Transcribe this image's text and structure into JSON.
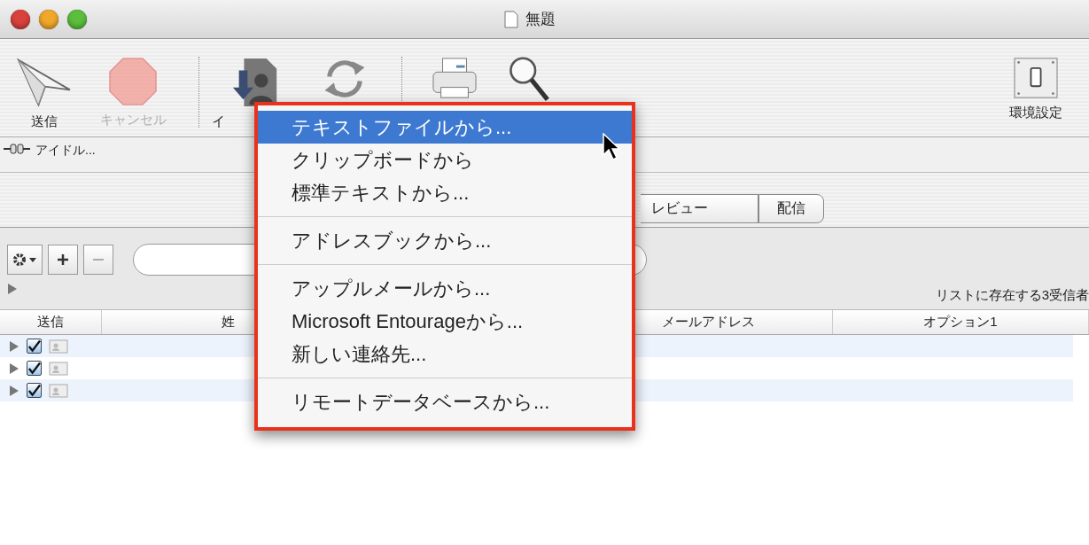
{
  "window": {
    "title": "無題"
  },
  "toolbar": [
    {
      "kind": "send",
      "label": "送信",
      "disabled": false
    },
    {
      "kind": "cancel",
      "label": "キャンセル",
      "disabled": true
    },
    {
      "kind": "separator"
    },
    {
      "kind": "import",
      "label": "イ",
      "disabled": false
    },
    {
      "kind": "refresh",
      "disabled": false
    },
    {
      "kind": "separator"
    },
    {
      "kind": "print",
      "disabled": false
    },
    {
      "kind": "search",
      "disabled": false
    },
    {
      "kind": "spacer"
    },
    {
      "kind": "preferences",
      "label": "環境設定",
      "disabled": false
    }
  ],
  "status": "アイドル...",
  "tabs": [
    {
      "label": "レビュー",
      "selected": false
    },
    {
      "label": "配信",
      "selected": false
    }
  ],
  "list_summary": "リストに存在する3受信者",
  "table": {
    "columns": [
      "送信",
      "姓",
      "メールアドレス",
      "オプション1"
    ],
    "rows": [
      {
        "checked": true
      },
      {
        "checked": true
      },
      {
        "checked": true
      }
    ]
  },
  "menu": {
    "groups": [
      [
        {
          "label": "テキストファイルから...",
          "selected": true
        },
        {
          "label": "クリップボードから",
          "selected": false
        },
        {
          "label": "標準テキストから...",
          "selected": false
        }
      ],
      [
        {
          "label": "アドレスブックから...",
          "selected": false
        }
      ],
      [
        {
          "label": "アップルメールから...",
          "selected": false
        },
        {
          "label": "Microsoft Entourageから...",
          "selected": false
        },
        {
          "label": "新しい連絡先...",
          "selected": false
        }
      ],
      [
        {
          "label": "リモートデータベースから...",
          "selected": false
        }
      ]
    ]
  }
}
